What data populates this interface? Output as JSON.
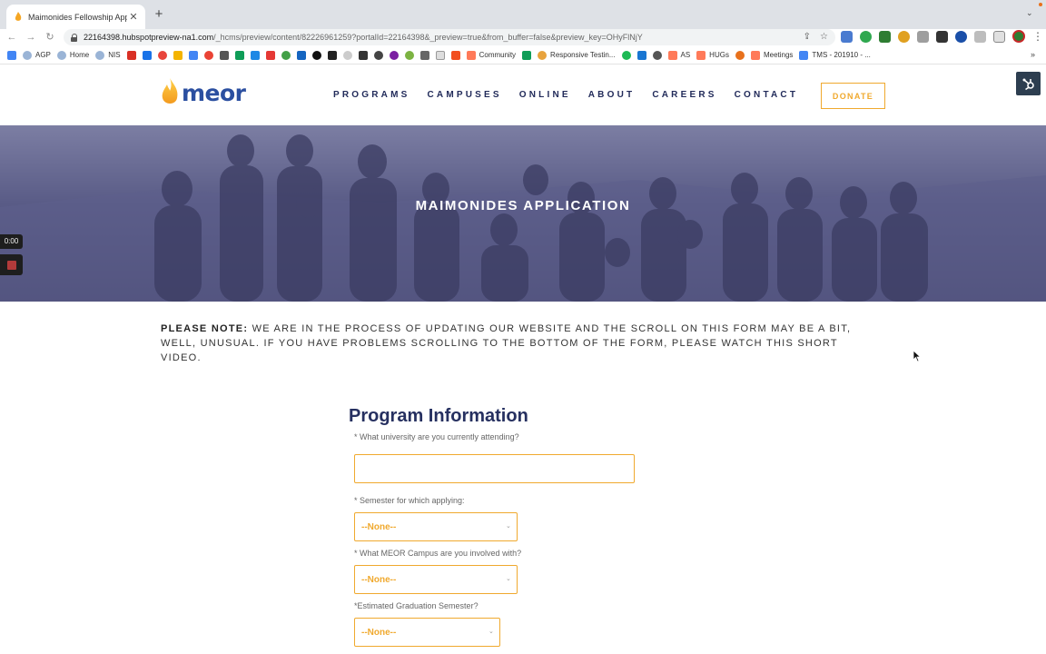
{
  "browser": {
    "tab_title": "Maimonides Fellowship Applic",
    "url_host": "22164398.hubspotpreview-na1.com",
    "url_path": "/_hcms/preview/content/82226961259?portalId=22164398&_preview=true&from_buffer=false&preview_key=OHyFlNjY",
    "bookmarks": [
      "AGP",
      "Home",
      "NIS",
      "Community",
      "Responsive Testin...",
      "AS",
      "HUGs",
      "Meetings",
      "TMS - 201910 - ..."
    ],
    "colors": {
      "tabstrip": "#dee1e6",
      "omnibox": "#f1f3f4"
    }
  },
  "site": {
    "logo_text": "meor",
    "nav": [
      "PROGRAMS",
      "CAMPUSES",
      "ONLINE",
      "ABOUT",
      "CAREERS",
      "CONTACT"
    ],
    "donate_label": "DONATE",
    "colors": {
      "brand_navy": "#222b5a",
      "accent_orange": "#f0a92e",
      "logo_blue": "#2b4fa0"
    }
  },
  "hero": {
    "title": "MAIMONIDES APPLICATION"
  },
  "recorder": {
    "time": "0:00"
  },
  "notice": {
    "bold_prefix": "PLEASE NOTE:",
    "text": " WE ARE IN THE PROCESS OF UPDATING OUR WEBSITE AND THE SCROLL ON THIS FORM MAY BE A BIT, WELL, UNUSUAL.  IF YOU HAVE PROBLEMS SCROLLING TO THE BOTTOM OF THE FORM, PLEASE WATCH THIS SHORT VIDEO."
  },
  "form": {
    "heading": "Program Information",
    "university_label": "* What university are you currently attending?",
    "university_value": "",
    "semester_label": "* Semester for which applying:",
    "semester_value": "--None--",
    "campus_label": "* What MEOR Campus are you involved with?",
    "campus_value": "--None--",
    "graduation_label": "*Estimated Graduation Semester?",
    "graduation_value": "--None--"
  }
}
